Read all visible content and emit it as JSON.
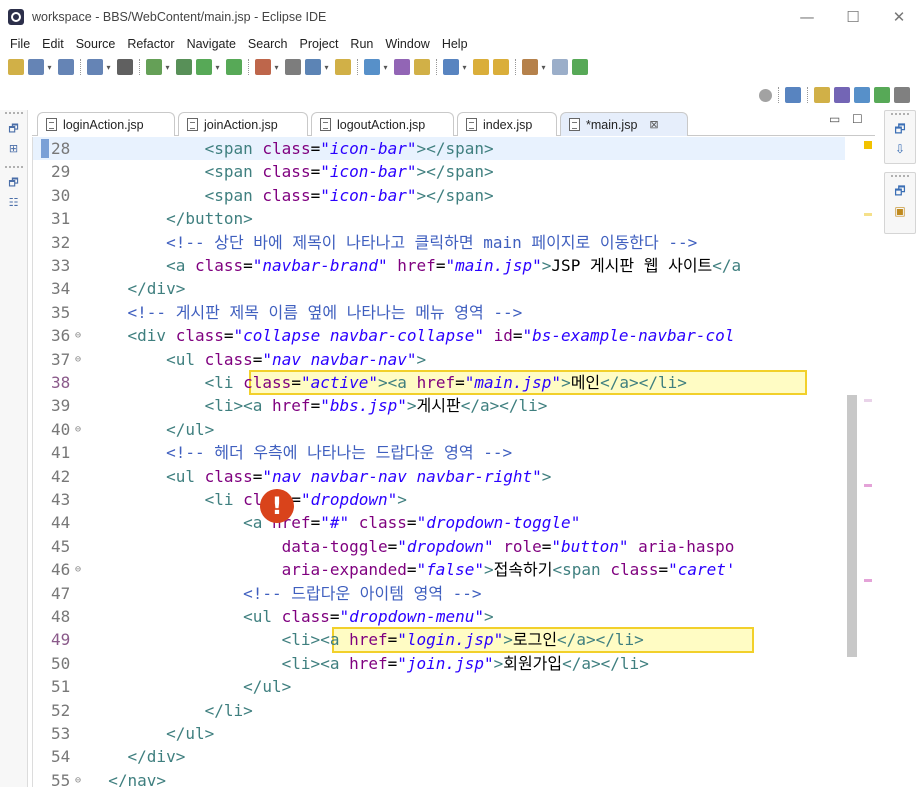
{
  "window": {
    "title": "workspace - BBS/WebContent/main.jsp - Eclipse IDE",
    "minimize": "—",
    "maximize": "☐",
    "close": "✕"
  },
  "menu": [
    "File",
    "Edit",
    "Source",
    "Refactor",
    "Navigate",
    "Search",
    "Project",
    "Run",
    "Window",
    "Help"
  ],
  "toolbar": {
    "icons": [
      "new-icon",
      "save-icon",
      "save-all-icon",
      "open-console-icon",
      "link-icon",
      "debug-icon",
      "external-tools-icon",
      "run-icon",
      "run-config-icon",
      "profile-icon",
      "terminal-icon",
      "new-server-icon",
      "new-package-icon",
      "new-class-icon",
      "open-type-icon",
      "open-task-icon",
      "search-icon",
      "annotation-next-icon",
      "annotation-prev-icon",
      "back-icon",
      "forward-icon",
      "pin-editor-icon"
    ],
    "right_icons": [
      "search-icon",
      "open-perspective-icon",
      "java-ee-perspective-icon",
      "debug-perspective-icon",
      "java-perspective-icon",
      "git-perspective-icon",
      "team-perspective-icon"
    ]
  },
  "tabs": [
    {
      "label": "loginAction.jsp",
      "active": false
    },
    {
      "label": "joinAction.jsp",
      "active": false
    },
    {
      "label": "logoutAction.jsp",
      "active": false
    },
    {
      "label": "index.jsp",
      "active": false
    },
    {
      "label": "*main.jsp",
      "active": true,
      "close": "⊠"
    }
  ],
  "editor_controls": {
    "minimize": "▭",
    "maximize": "☐"
  },
  "lines": [
    {
      "n": "28",
      "fold": "",
      "tokens": [
        [
          "txt",
          "            "
        ],
        [
          "tag",
          "<span"
        ],
        [
          "txt",
          " "
        ],
        [
          "attr",
          "class"
        ],
        [
          "txt",
          "="
        ],
        [
          "val",
          "\"icon-bar\""
        ],
        [
          "tag",
          ">"
        ],
        [
          "tag",
          "</span>"
        ]
      ],
      "current": true
    },
    {
      "n": "29",
      "fold": "",
      "tokens": [
        [
          "txt",
          "            "
        ],
        [
          "tag",
          "<span"
        ],
        [
          "txt",
          " "
        ],
        [
          "attr",
          "class"
        ],
        [
          "txt",
          "="
        ],
        [
          "val",
          "\"icon-bar\""
        ],
        [
          "tag",
          ">"
        ],
        [
          "tag",
          "</span>"
        ]
      ]
    },
    {
      "n": "30",
      "fold": "",
      "tokens": [
        [
          "txt",
          "            "
        ],
        [
          "tag",
          "<span"
        ],
        [
          "txt",
          " "
        ],
        [
          "attr",
          "class"
        ],
        [
          "txt",
          "="
        ],
        [
          "val",
          "\"icon-bar\""
        ],
        [
          "tag",
          ">"
        ],
        [
          "tag",
          "</span>"
        ]
      ]
    },
    {
      "n": "31",
      "fold": "",
      "tokens": [
        [
          "txt",
          "        "
        ],
        [
          "tag",
          "</button>"
        ]
      ]
    },
    {
      "n": "32",
      "fold": "",
      "tokens": [
        [
          "txt",
          "        "
        ],
        [
          "cmt",
          "<!-- 상단 바에 제목이 나타나고 클릭하면 main 페이지로 이동한다 -->"
        ]
      ]
    },
    {
      "n": "33",
      "fold": "",
      "tokens": [
        [
          "txt",
          "        "
        ],
        [
          "tag",
          "<a"
        ],
        [
          "txt",
          " "
        ],
        [
          "attr",
          "class"
        ],
        [
          "txt",
          "="
        ],
        [
          "val",
          "\"navbar-brand\""
        ],
        [
          "txt",
          " "
        ],
        [
          "attr",
          "href"
        ],
        [
          "txt",
          "="
        ],
        [
          "val",
          "\"main.jsp\""
        ],
        [
          "tag",
          ">"
        ],
        [
          "txt",
          "JSP 게시판 웹 사이트"
        ],
        [
          "tag",
          "</a"
        ]
      ]
    },
    {
      "n": "34",
      "fold": "",
      "tokens": [
        [
          "txt",
          "    "
        ],
        [
          "tag",
          "</div>"
        ]
      ]
    },
    {
      "n": "35",
      "fold": "",
      "tokens": [
        [
          "txt",
          "    "
        ],
        [
          "cmt",
          "<!-- 게시판 제목 이름 옆에 나타나는 메뉴 영역 -->"
        ]
      ]
    },
    {
      "n": "36",
      "fold": "⊖",
      "tokens": [
        [
          "txt",
          "    "
        ],
        [
          "tag",
          "<div"
        ],
        [
          "txt",
          " "
        ],
        [
          "attr",
          "class"
        ],
        [
          "txt",
          "="
        ],
        [
          "val",
          "\"collapse navbar-collapse\""
        ],
        [
          "txt",
          " "
        ],
        [
          "attr",
          "id"
        ],
        [
          "txt",
          "="
        ],
        [
          "val",
          "\"bs-example-navbar-col"
        ]
      ]
    },
    {
      "n": "37",
      "fold": "⊖",
      "tokens": [
        [
          "txt",
          "        "
        ],
        [
          "tag",
          "<ul"
        ],
        [
          "txt",
          " "
        ],
        [
          "attr",
          "class"
        ],
        [
          "txt",
          "="
        ],
        [
          "val",
          "\"nav navbar-nav\""
        ],
        [
          "tag",
          ">"
        ]
      ]
    },
    {
      "n": "38",
      "fold": "",
      "err": true,
      "tokens": [
        [
          "txt",
          "            "
        ],
        [
          "tag",
          "<li"
        ],
        [
          "txt",
          " "
        ],
        [
          "attr",
          "class"
        ],
        [
          "txt",
          "="
        ],
        [
          "val",
          "\"active\""
        ],
        [
          "tag",
          ">"
        ],
        [
          "tag",
          "<a"
        ],
        [
          "txt",
          " "
        ],
        [
          "attr",
          "href"
        ],
        [
          "txt",
          "="
        ],
        [
          "val",
          "\"main.jsp\""
        ],
        [
          "tag",
          ">"
        ],
        [
          "txt",
          "메인"
        ],
        [
          "tag",
          "</a></li>"
        ]
      ]
    },
    {
      "n": "39",
      "fold": "",
      "tokens": [
        [
          "txt",
          "            "
        ],
        [
          "tag",
          "<li>"
        ],
        [
          "tag",
          "<a"
        ],
        [
          "txt",
          " "
        ],
        [
          "attr",
          "href"
        ],
        [
          "txt",
          "="
        ],
        [
          "val",
          "\"bbs.jsp\""
        ],
        [
          "tag",
          ">"
        ],
        [
          "txt",
          "게시판"
        ],
        [
          "tag",
          "</a></li>"
        ]
      ]
    },
    {
      "n": "40",
      "fold": "⊖",
      "tokens": [
        [
          "txt",
          "        "
        ],
        [
          "tag",
          "</ul>"
        ]
      ]
    },
    {
      "n": "41",
      "fold": "",
      "tokens": [
        [
          "txt",
          "        "
        ],
        [
          "cmt",
          "<!-- 헤더 우측에 나타나는 드랍다운 영역 -->"
        ]
      ]
    },
    {
      "n": "42",
      "fold": "",
      "tokens": [
        [
          "txt",
          "        "
        ],
        [
          "tag",
          "<ul"
        ],
        [
          "txt",
          " "
        ],
        [
          "attr",
          "class"
        ],
        [
          "txt",
          "="
        ],
        [
          "val",
          "\"nav navbar-nav navbar-right\""
        ],
        [
          "tag",
          ">"
        ]
      ]
    },
    {
      "n": "43",
      "fold": "",
      "tokens": [
        [
          "txt",
          "            "
        ],
        [
          "tag",
          "<li"
        ],
        [
          "txt",
          " "
        ],
        [
          "attr",
          "class"
        ],
        [
          "txt",
          "="
        ],
        [
          "val",
          "\"dropdown\""
        ],
        [
          "tag",
          ">"
        ]
      ]
    },
    {
      "n": "44",
      "fold": "",
      "tokens": [
        [
          "txt",
          "                "
        ],
        [
          "tag",
          "<a"
        ],
        [
          "txt",
          " "
        ],
        [
          "attr",
          "href"
        ],
        [
          "txt",
          "="
        ],
        [
          "val",
          "\"#\""
        ],
        [
          "txt",
          " "
        ],
        [
          "attr",
          "class"
        ],
        [
          "txt",
          "="
        ],
        [
          "val",
          "\"dropdown-toggle\""
        ]
      ]
    },
    {
      "n": "45",
      "fold": "",
      "tokens": [
        [
          "txt",
          "                    "
        ],
        [
          "attr",
          "data-toggle"
        ],
        [
          "txt",
          "="
        ],
        [
          "val",
          "\"dropdown\""
        ],
        [
          "txt",
          " "
        ],
        [
          "attr",
          "role"
        ],
        [
          "txt",
          "="
        ],
        [
          "val",
          "\"button\""
        ],
        [
          "txt",
          " "
        ],
        [
          "attr",
          "aria-haspo"
        ]
      ]
    },
    {
      "n": "46",
      "fold": "⊖",
      "tokens": [
        [
          "txt",
          "                    "
        ],
        [
          "attr",
          "aria-expanded"
        ],
        [
          "txt",
          "="
        ],
        [
          "val",
          "\"false\""
        ],
        [
          "tag",
          ">"
        ],
        [
          "txt",
          "접속하기"
        ],
        [
          "tag",
          "<span"
        ],
        [
          "txt",
          " "
        ],
        [
          "attr",
          "class"
        ],
        [
          "txt",
          "="
        ],
        [
          "val",
          "\"caret'"
        ]
      ]
    },
    {
      "n": "47",
      "fold": "",
      "tokens": [
        [
          "txt",
          "                "
        ],
        [
          "cmt",
          "<!-- 드랍다운 아이템 영역 -->"
        ]
      ]
    },
    {
      "n": "48",
      "fold": "",
      "tokens": [
        [
          "txt",
          "                "
        ],
        [
          "tag",
          "<ul"
        ],
        [
          "txt",
          " "
        ],
        [
          "attr",
          "class"
        ],
        [
          "txt",
          "="
        ],
        [
          "val",
          "\"dropdown-menu\""
        ],
        [
          "tag",
          ">"
        ]
      ]
    },
    {
      "n": "49",
      "fold": "",
      "err": true,
      "tokens": [
        [
          "txt",
          "                    "
        ],
        [
          "tag",
          "<li>"
        ],
        [
          "tag",
          "<a"
        ],
        [
          "txt",
          " "
        ],
        [
          "attr",
          "href"
        ],
        [
          "txt",
          "="
        ],
        [
          "val",
          "\"login.jsp\""
        ],
        [
          "tag",
          ">"
        ],
        [
          "txt",
          "로그인"
        ],
        [
          "tag",
          "</a></li>"
        ]
      ]
    },
    {
      "n": "50",
      "fold": "",
      "tokens": [
        [
          "txt",
          "                    "
        ],
        [
          "tag",
          "<li>"
        ],
        [
          "tag",
          "<a"
        ],
        [
          "txt",
          " "
        ],
        [
          "attr",
          "href"
        ],
        [
          "txt",
          "="
        ],
        [
          "val",
          "\"join.jsp\""
        ],
        [
          "tag",
          ">"
        ],
        [
          "txt",
          "회원가입"
        ],
        [
          "tag",
          "</a></li>"
        ]
      ]
    },
    {
      "n": "51",
      "fold": "",
      "tokens": [
        [
          "txt",
          "                "
        ],
        [
          "tag",
          "</ul>"
        ]
      ]
    },
    {
      "n": "52",
      "fold": "",
      "tokens": [
        [
          "txt",
          "            "
        ],
        [
          "tag",
          "</li>"
        ]
      ]
    },
    {
      "n": "53",
      "fold": "",
      "tokens": [
        [
          "txt",
          "        "
        ],
        [
          "tag",
          "</ul>"
        ]
      ]
    },
    {
      "n": "54",
      "fold": "",
      "tokens": [
        [
          "txt",
          "    "
        ],
        [
          "tag",
          "</div>"
        ]
      ]
    },
    {
      "n": "55",
      "fold": "⊖",
      "tokens": [
        [
          "txt",
          "  "
        ],
        [
          "tag",
          "</nav>"
        ]
      ]
    }
  ],
  "error_badge": "!",
  "colors": {
    "highlight_border": "#f2d02a",
    "highlight_fill": "#fffcc4",
    "error_badge": "#d9431b",
    "current_line": "#e8f2fe"
  }
}
